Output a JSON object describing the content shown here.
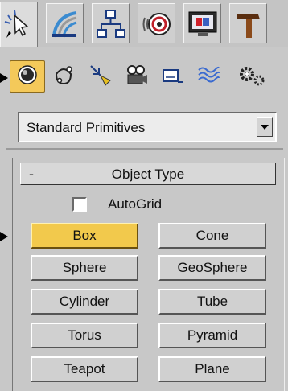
{
  "main_tabs": [
    {
      "name": "create-tab-icon",
      "active": true
    },
    {
      "name": "modify-tab-icon",
      "active": false
    },
    {
      "name": "hierarchy-tab-icon",
      "active": false
    },
    {
      "name": "motion-tab-icon",
      "active": false
    },
    {
      "name": "display-tab-icon",
      "active": false
    },
    {
      "name": "utilities-tab-icon",
      "active": false
    }
  ],
  "category_icons": [
    "geometry-icon",
    "shapes-icon",
    "lights-icon",
    "cameras-icon",
    "helpers-icon",
    "space-warps-icon",
    "systems-icon"
  ],
  "dropdown": {
    "selected": "Standard Primitives"
  },
  "rollout": {
    "collapse_symbol": "-",
    "title": "Object Type",
    "autogrid_label": "AutoGrid"
  },
  "buttons": {
    "box": "Box",
    "cone": "Cone",
    "sphere": "Sphere",
    "geosphere": "GeoSphere",
    "cylinder": "Cylinder",
    "tube": "Tube",
    "torus": "Torus",
    "pyramid": "Pyramid",
    "teapot": "Teapot",
    "plane": "Plane"
  },
  "colors": {
    "selected": "#f2c94c",
    "panel": "#c8c8c8"
  }
}
